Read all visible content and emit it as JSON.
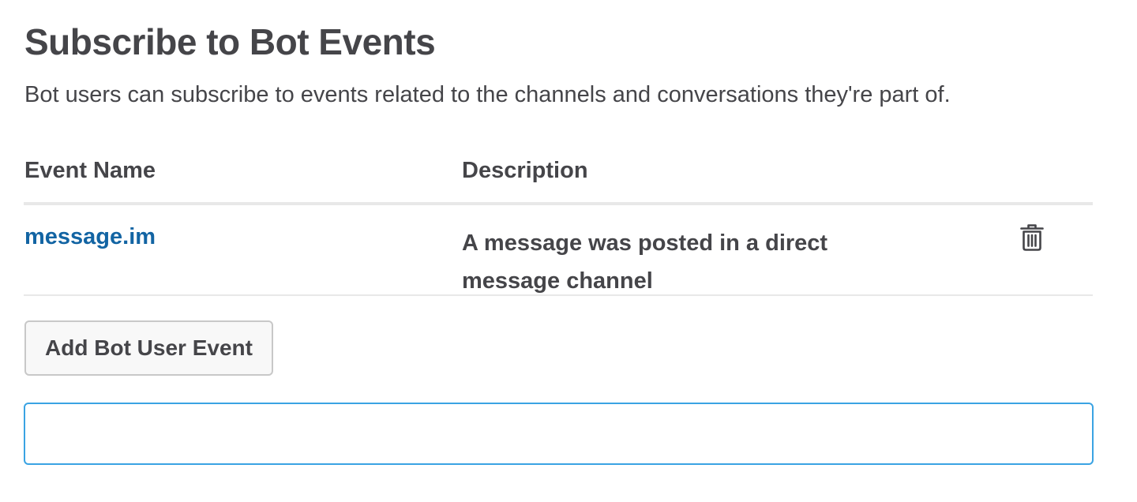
{
  "section": {
    "title": "Subscribe to Bot Events",
    "subtitle": "Bot users can subscribe to events related to the channels and conversations they're part of."
  },
  "table": {
    "columns": {
      "event_name": "Event Name",
      "description": "Description"
    },
    "rows": [
      {
        "event_name": "message.im",
        "description_line1": "A message was posted in a direct",
        "description_line2": "message channel",
        "action_icon": "trash-icon"
      }
    ]
  },
  "actions": {
    "add_button_label": "Add Bot User Event"
  },
  "search": {
    "value": "",
    "placeholder": ""
  },
  "colors": {
    "text": "#454549",
    "link": "#1264a3",
    "input_focus_border": "#3aa3e3",
    "divider": "#e8e8e8"
  }
}
